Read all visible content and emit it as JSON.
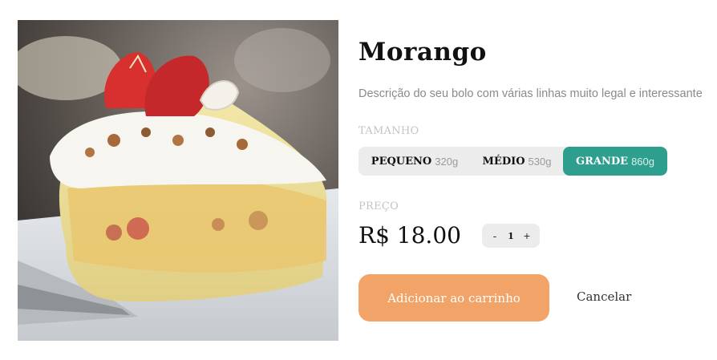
{
  "product": {
    "title": "Morango",
    "description": "Descrição do seu bolo com várias linhas muito legal e interessante",
    "image_alt": "strawberry cake slice photo"
  },
  "size": {
    "label": "TAMANHO",
    "options": [
      {
        "name": "PEQUENO",
        "weight": "320g",
        "selected": false
      },
      {
        "name": "MÉDIO",
        "weight": "530g",
        "selected": false
      },
      {
        "name": "GRANDE",
        "weight": "860g",
        "selected": true
      }
    ]
  },
  "price": {
    "label": "PREÇO",
    "value": "R$ 18.00"
  },
  "quantity": {
    "minus": "-",
    "value": "1",
    "plus": "+"
  },
  "actions": {
    "add_to_cart": "Adicionar ao carrinho",
    "cancel": "Cancelar"
  },
  "colors": {
    "accent_selected": "#2e9e8e",
    "primary_button": "#f2a468",
    "muted_text": "#8a8a8a",
    "label_text": "#c4c4c4",
    "toggle_bg": "#ececec"
  }
}
